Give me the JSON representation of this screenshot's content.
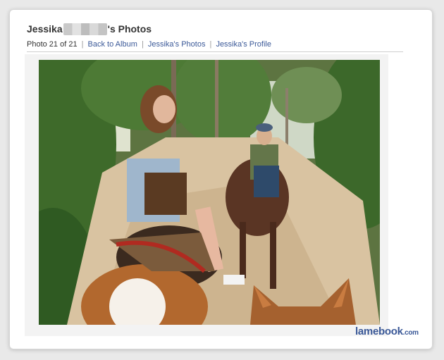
{
  "header": {
    "first_name": "Jessika",
    "suffix": "'s Photos"
  },
  "nav": {
    "counter": "Photo 21 of 21",
    "back_link": "Back to Album",
    "photos_link": "Jessika's Photos",
    "profile_link": "Jessika's Profile",
    "separator": "|"
  },
  "watermark": {
    "brand": "lamebook",
    "domain": ".com"
  },
  "colors": {
    "link": "#3b5998",
    "text": "#333333"
  }
}
